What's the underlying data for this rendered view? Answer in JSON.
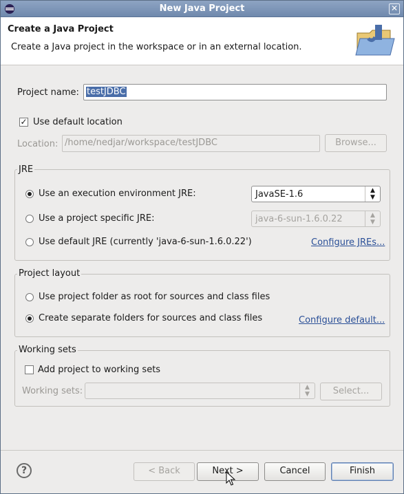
{
  "window": {
    "title": "New Java Project"
  },
  "header": {
    "title": "Create a Java Project",
    "description": "Create a Java project in the workspace or in an external location."
  },
  "project": {
    "name_label": "Project name:",
    "name_value": "testJDBC"
  },
  "location": {
    "use_default_label": "Use default location",
    "use_default_checked": true,
    "label": "Location:",
    "value": "/home/nedjar/workspace/testJDBC",
    "browse_label": "Browse..."
  },
  "jre": {
    "group_title": "JRE",
    "options": [
      {
        "label": "Use an execution environment JRE:",
        "selected": true
      },
      {
        "label": "Use a project specific JRE:",
        "selected": false
      },
      {
        "label": "Use default JRE (currently 'java-6-sun-1.6.0.22')",
        "selected": false
      }
    ],
    "env_value": "JavaSE-1.6",
    "specific_value": "java-6-sun-1.6.0.22",
    "configure_link": "Configure JREs..."
  },
  "layout": {
    "group_title": "Project layout",
    "options": [
      {
        "label": "Use project folder as root for sources and class files",
        "selected": false
      },
      {
        "label": "Create separate folders for sources and class files",
        "selected": true
      }
    ],
    "configure_link": "Configure default..."
  },
  "working_sets": {
    "group_title": "Working sets",
    "add_label": "Add project to working sets",
    "add_checked": false,
    "label": "Working sets:",
    "value": "",
    "select_label": "Select..."
  },
  "buttons": {
    "back": "< Back",
    "next": "Next >",
    "cancel": "Cancel",
    "finish": "Finish"
  },
  "icons": {
    "help": "help-icon",
    "app": "eclipse-icon",
    "wizard": "java-project-wizard-icon"
  },
  "colors": {
    "titlebar": "#7a93b8",
    "selection": "#4a6ea9",
    "link": "#2a4f97"
  }
}
